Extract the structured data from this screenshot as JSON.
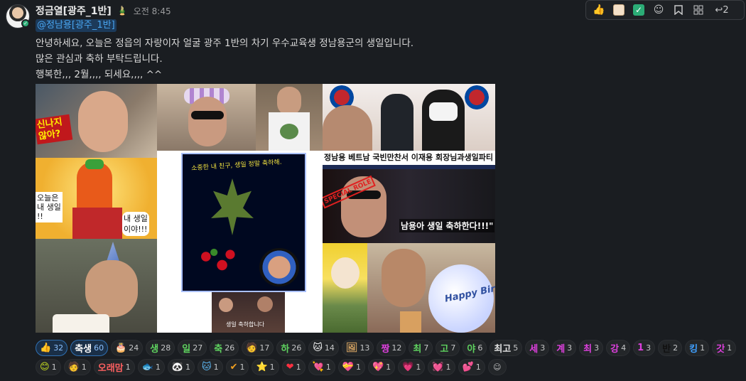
{
  "message": {
    "sender": "정금열[광주_1반]",
    "status_emoji": "🎍",
    "time": "오전 8:45",
    "mention": "@정남용[광주_1반]",
    "lines": [
      "안녕하세요, 오늘은 정읍의 자랑이자 얼굴 광주 1반의 차기 우수교육생 정남용군의 생일입니다.",
      "많은 관심과 축하 부탁드립니다.",
      "행복한,,, 2월,,,, 되세요,,,, ^^"
    ]
  },
  "toolbar": {
    "icons": [
      "thumbs-up-icon",
      "face-icon",
      "checkmark-icon",
      "add-reaction-icon",
      "bookmark-icon",
      "grid-icon"
    ],
    "reply_count": "2"
  },
  "collage": {
    "captions": {
      "tile1": "신나지\n않아?",
      "tile_cartoon_a": "오늘은\n내 생일\n!!",
      "tile_cartoon_b": "내 생일\n이야!!!",
      "center_top": "소중한 내 친구, 생일 정말 축하해.",
      "center_bottom": "생일 축하합니다",
      "news_banner": "정남용 베트남 국빈만찬서 이재용 회장님과생일파티",
      "stamp": "SPECIAL ROLE",
      "concert": "남용아 생일 축하한다!!!\"",
      "balloon": "Happy Birthday"
    }
  },
  "reactions": [
    {
      "e": "👍",
      "n": "32",
      "sel": true,
      "c": "#f1c40f"
    },
    {
      "e": "축생",
      "n": "60",
      "sel": true,
      "c": "#ffffff"
    },
    {
      "e": "🎂",
      "n": "24",
      "sel": false,
      "c": "#ffffff"
    },
    {
      "e": "생",
      "n": "28",
      "sel": false,
      "c": "#5fd35f"
    },
    {
      "e": "일",
      "n": "27",
      "sel": false,
      "c": "#5fd35f"
    },
    {
      "e": "축",
      "n": "26",
      "sel": false,
      "c": "#5fd35f"
    },
    {
      "e": "🧑",
      "n": "17",
      "sel": false,
      "c": "#e0b090"
    },
    {
      "e": "하",
      "n": "26",
      "sel": false,
      "c": "#5fd35f"
    },
    {
      "e": "🐱",
      "n": "14",
      "sel": false,
      "c": "#ffffff"
    },
    {
      "e": "🖼",
      "n": "13",
      "sel": false,
      "c": "#d0a060"
    },
    {
      "e": "짱",
      "n": "12",
      "sel": false,
      "c": "#e040e0"
    },
    {
      "e": "최",
      "n": "7",
      "sel": false,
      "c": "#5fd35f"
    },
    {
      "e": "고",
      "n": "7",
      "sel": false,
      "c": "#5fd35f"
    },
    {
      "e": "야",
      "n": "6",
      "sel": false,
      "c": "#5fd35f"
    },
    {
      "e": "최고",
      "n": "5",
      "sel": false,
      "c": "#e0e0e0"
    },
    {
      "e": "세",
      "n": "3",
      "sel": false,
      "c": "#e040e0"
    },
    {
      "e": "계",
      "n": "3",
      "sel": false,
      "c": "#e040e0"
    },
    {
      "e": "최",
      "n": "3",
      "sel": false,
      "c": "#e040e0"
    },
    {
      "e": "강",
      "n": "4",
      "sel": false,
      "c": "#e040e0"
    },
    {
      "e": "1",
      "n": "3",
      "sel": false,
      "c": "#e040e0"
    },
    {
      "e": "반",
      "n": "2",
      "sel": false,
      "c": "#111111"
    },
    {
      "e": "킹",
      "n": "1",
      "sel": false,
      "c": "#40a0ff"
    },
    {
      "e": "갓",
      "n": "1",
      "sel": false,
      "c": "#e040e0"
    },
    {
      "e": "😊",
      "n": "1",
      "sel": false,
      "c": "#c8e020"
    },
    {
      "e": "🧑",
      "n": "1",
      "sel": false,
      "c": "#e0b090"
    },
    {
      "e": "오래맘",
      "n": "1",
      "sel": false,
      "c": "#ff6060"
    },
    {
      "e": "🐟",
      "n": "1",
      "sel": false,
      "c": "#60b0ff"
    },
    {
      "e": "🐼",
      "n": "1",
      "sel": false,
      "c": "#ffffff"
    },
    {
      "e": "🐱",
      "n": "1",
      "sel": false,
      "c": "#60c0ff"
    },
    {
      "e": "✔",
      "n": "1",
      "sel": false,
      "c": "#f0a020"
    },
    {
      "e": "⭐",
      "n": "1",
      "sel": false,
      "c": "#f0d020"
    },
    {
      "e": "❤",
      "n": "1",
      "sel": false,
      "c": "#ff3040"
    },
    {
      "e": "💘",
      "n": "1",
      "sel": false,
      "c": "#ff4080"
    },
    {
      "e": "💝",
      "n": "1",
      "sel": false,
      "c": "#ff4080"
    },
    {
      "e": "💖",
      "n": "1",
      "sel": false,
      "c": "#ff60a0"
    },
    {
      "e": "💗",
      "n": "1",
      "sel": false,
      "c": "#ff60c0"
    },
    {
      "e": "💓",
      "n": "1",
      "sel": false,
      "c": "#ff40c0"
    },
    {
      "e": "💕",
      "n": "1",
      "sel": false,
      "c": "#ff60c0"
    }
  ]
}
